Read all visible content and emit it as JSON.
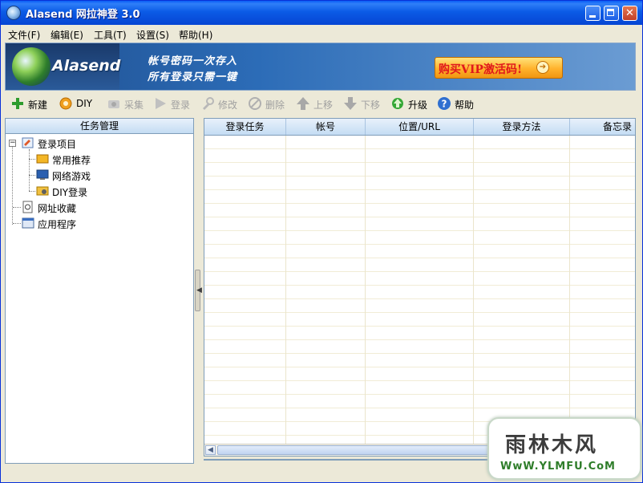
{
  "window": {
    "title": "Alasend 网拉神登 3.0",
    "controls": [
      "minimize",
      "maximize",
      "close"
    ]
  },
  "menu": [
    {
      "label": "文件(F)"
    },
    {
      "label": "编辑(E)"
    },
    {
      "label": "工具(T)"
    },
    {
      "label": "设置(S)"
    },
    {
      "label": "帮助(H)"
    }
  ],
  "banner": {
    "logo_text": "Alasend",
    "slogan_line1": "帐号密码一次存入",
    "slogan_line2": "所有登录只需一键",
    "vip_button": "购买VIP激活码!"
  },
  "toolbar": [
    {
      "label": "新建",
      "icon": "plus-icon",
      "enabled": true
    },
    {
      "label": "DIY",
      "icon": "gear-icon",
      "enabled": true
    },
    {
      "label": "采集",
      "icon": "collect-icon",
      "enabled": false
    },
    {
      "label": "登录",
      "icon": "play-icon",
      "enabled": false
    },
    {
      "label": "修改",
      "icon": "wrench-icon",
      "enabled": false
    },
    {
      "label": "删除",
      "icon": "delete-icon",
      "enabled": false
    },
    {
      "label": "上移",
      "icon": "arrow-up-icon",
      "enabled": false
    },
    {
      "label": "下移",
      "icon": "arrow-down-icon",
      "enabled": false
    },
    {
      "label": "升级",
      "icon": "upgrade-icon",
      "enabled": true
    },
    {
      "label": "帮助",
      "icon": "help-icon",
      "enabled": true
    }
  ],
  "left_panel": {
    "header": "任务管理",
    "tree": {
      "root": {
        "label": "登录项目",
        "expanded": true
      },
      "children": [
        {
          "label": "常用推荐",
          "icon": "folder-icon"
        },
        {
          "label": "网络游戏",
          "icon": "monitor-icon"
        },
        {
          "label": "DIY登录",
          "icon": "diy-icon"
        }
      ],
      "siblings": [
        {
          "label": "网址收藏",
          "icon": "bookmark-icon"
        },
        {
          "label": "应用程序",
          "icon": "app-icon"
        }
      ]
    }
  },
  "grid": {
    "columns": [
      "登录任务",
      "帐号",
      "位置/URL",
      "登录方法",
      "备忘录"
    ],
    "rows": []
  },
  "watermark": {
    "logo": "雨林木风",
    "url": "WwW.YLMFU.CoM"
  },
  "colors": {
    "titlebar": "#0a5df6",
    "window_bg": "#ece9d8",
    "header_bg": "#c4dcf3",
    "vip_text": "#e0181c",
    "watermark_url": "#2f7d2a"
  }
}
